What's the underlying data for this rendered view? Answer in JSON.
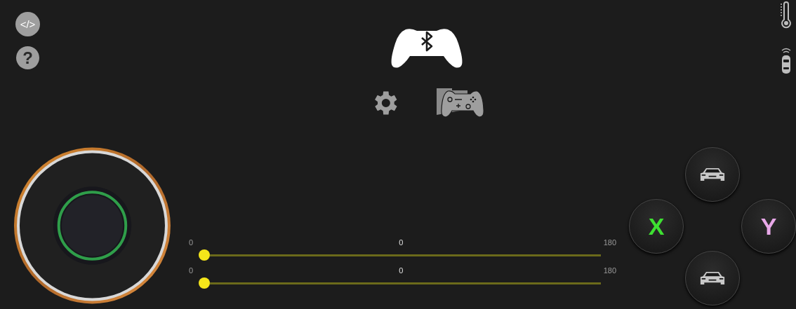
{
  "top_left_buttons": [
    {
      "kind": "code",
      "label": "</>"
    },
    {
      "kind": "help",
      "label": "?"
    }
  ],
  "sliders": [
    {
      "min": "0",
      "value": "0",
      "max": "180",
      "level": 0
    },
    {
      "min": "0",
      "value": "0",
      "max": "180",
      "level": 0
    }
  ],
  "action_buttons": [
    {
      "kind": "car"
    },
    {
      "kind": "letter",
      "label": "X",
      "color": "#3ee032"
    },
    {
      "kind": "letter",
      "label": "Y",
      "color": "#e8a8e8"
    },
    {
      "kind": "car"
    }
  ]
}
